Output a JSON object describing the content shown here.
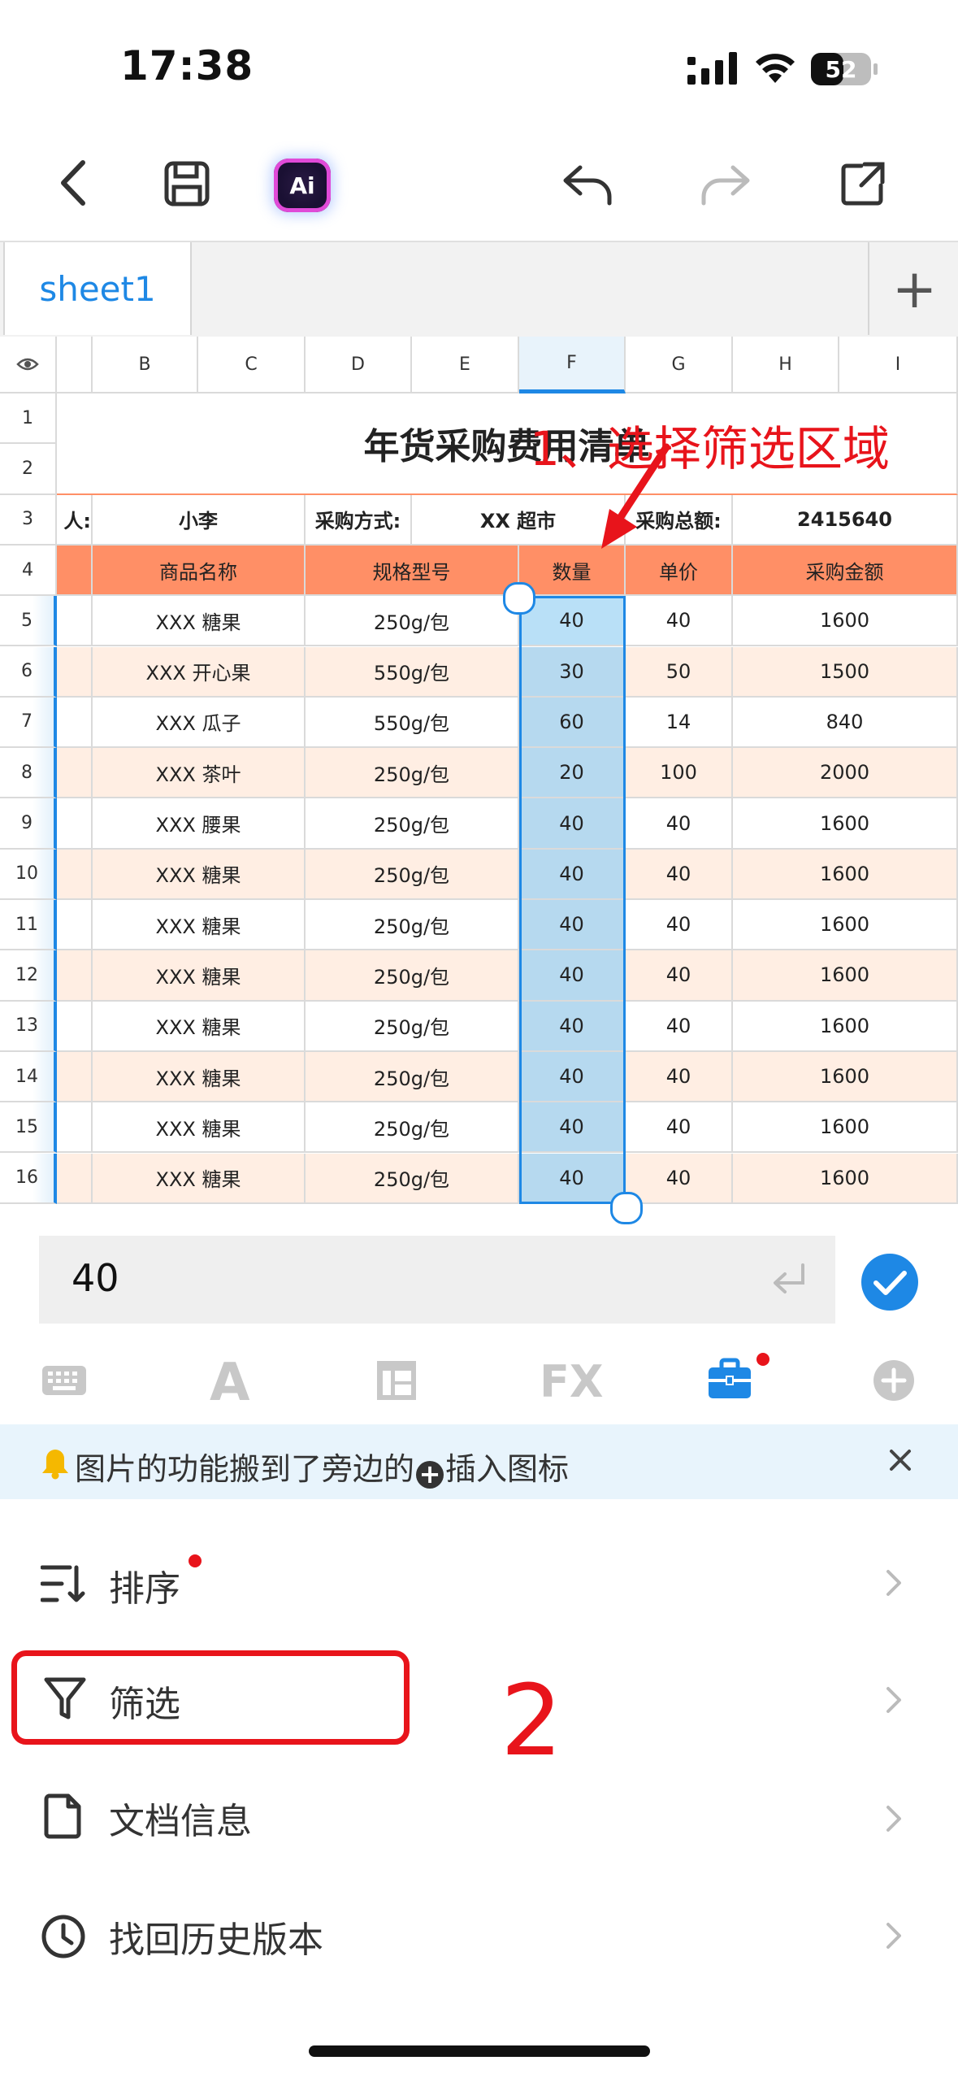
{
  "status_bar": {
    "time": "17:38",
    "battery_level": "52"
  },
  "sheet_tabs": {
    "active": "sheet1",
    "add_label": "+"
  },
  "columns": [
    "B",
    "C",
    "D",
    "E",
    "F",
    "G",
    "H",
    "I"
  ],
  "rows": [
    "1",
    "2",
    "3",
    "4",
    "5",
    "6",
    "7",
    "8",
    "9",
    "10",
    "11",
    "12",
    "13",
    "14",
    "15",
    "16"
  ],
  "sheet": {
    "title": "年货采购费用清单",
    "buyer_label_partial": "人:",
    "buyer": "小李",
    "method_label": "采购方式:",
    "method": "XX 超市",
    "total_label": "采购总额:",
    "total": "2415640",
    "headers": [
      "商品名称",
      "规格型号",
      "数量",
      "单价",
      "采购金额"
    ],
    "items": [
      [
        "XXX 糖果",
        "250g/包",
        "40",
        "40",
        "1600"
      ],
      [
        "XXX 开心果",
        "550g/包",
        "30",
        "50",
        "1500"
      ],
      [
        "XXX 瓜子",
        "550g/包",
        "60",
        "14",
        "840"
      ],
      [
        "XXX 茶叶",
        "250g/包",
        "20",
        "100",
        "2000"
      ],
      [
        "XXX 腰果",
        "250g/包",
        "40",
        "40",
        "1600"
      ],
      [
        "XXX 糖果",
        "250g/包",
        "40",
        "40",
        "1600"
      ],
      [
        "XXX 糖果",
        "250g/包",
        "40",
        "40",
        "1600"
      ],
      [
        "XXX 糖果",
        "250g/包",
        "40",
        "40",
        "1600"
      ],
      [
        "XXX 糖果",
        "250g/包",
        "40",
        "40",
        "1600"
      ],
      [
        "XXX 糖果",
        "250g/包",
        "40",
        "40",
        "1600"
      ],
      [
        "XXX 糖果",
        "250g/包",
        "40",
        "40",
        "1600"
      ],
      [
        "XXX 糖果",
        "250g/包",
        "40",
        "40",
        "1600"
      ]
    ]
  },
  "annotations": {
    "step1": "1、选择筛选区域",
    "step2": "2"
  },
  "formula_bar": {
    "value": "40"
  },
  "tip": {
    "text_before": "图片的功能搬到了旁边的",
    "text_after": "插入图标"
  },
  "menu": {
    "sort": "排序",
    "filter": "筛选",
    "doc_info": "文档信息",
    "history": "找回历史版本"
  },
  "colors": {
    "accent": "#1e88e5",
    "header_fill": "#ff8f66",
    "alt_row": "#ffeee3",
    "annotation_red": "#e8141b",
    "selection": "#b6d9ef"
  }
}
